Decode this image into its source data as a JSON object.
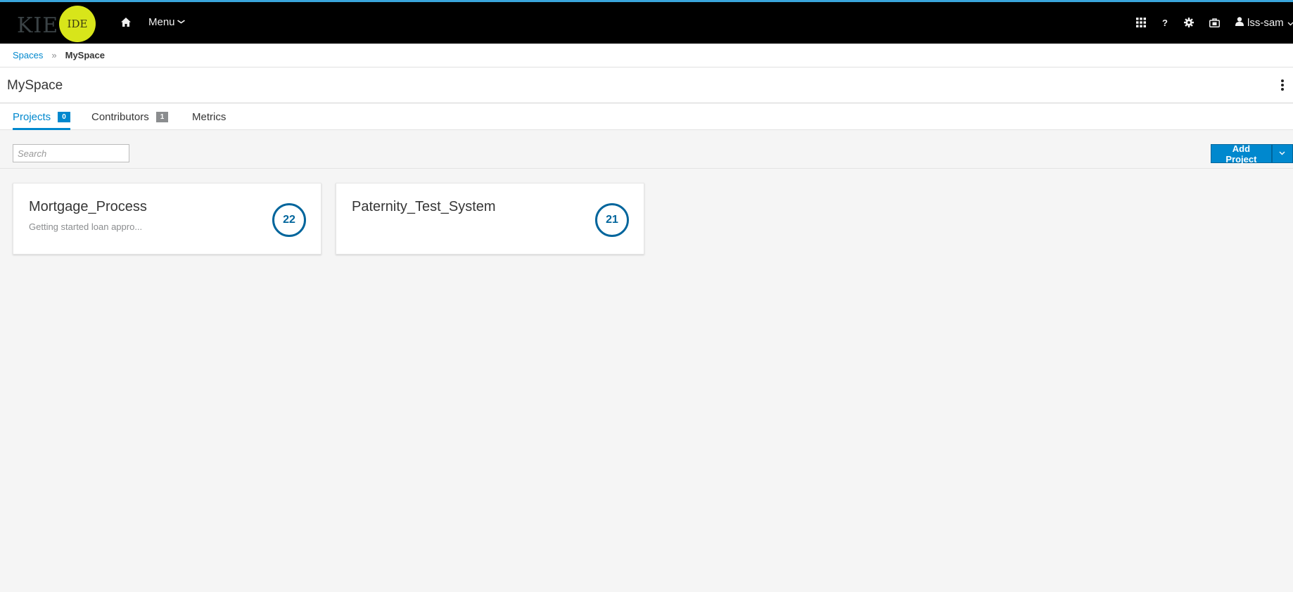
{
  "brand": {
    "name": "KIE",
    "badge": "IDE"
  },
  "navbar": {
    "menu_label": "Menu",
    "user_label": "lss-sam",
    "icons": [
      "home-icon",
      "apps-grid-icon",
      "help-icon",
      "gear-icon",
      "briefcase-icon",
      "user-icon"
    ],
    "help_glyph": "?"
  },
  "breadcrumb": {
    "root": "Spaces",
    "separator": "»",
    "current": "MySpace"
  },
  "page": {
    "title": "MySpace"
  },
  "tabs": [
    {
      "label": "Projects",
      "badge": "0",
      "active": true
    },
    {
      "label": "Contributors",
      "badge": "1",
      "active": false
    },
    {
      "label": "Metrics",
      "active": false
    }
  ],
  "toolbar": {
    "search_placeholder": "Search",
    "add_project_label": "Add Project"
  },
  "projects": [
    {
      "name": "Mortgage_Process",
      "description": "Getting started loan appro...",
      "count": "22"
    },
    {
      "name": "Paternity_Test_System",
      "description": "",
      "count": "21"
    }
  ],
  "colors": {
    "accent": "#0088ce",
    "navbar": "#000000",
    "brand_badge": "#d8e51a",
    "count_ring": "#00659c"
  }
}
